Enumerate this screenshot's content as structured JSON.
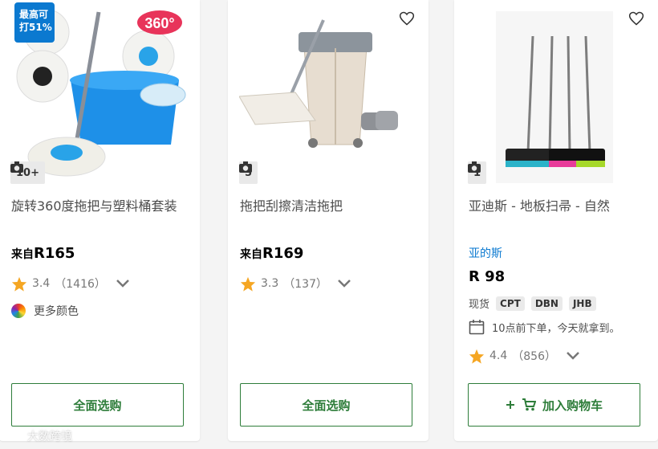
{
  "cards": [
    {
      "badge_line1": "最高可",
      "badge_line2": "打51%",
      "photo_count": "10+",
      "title": "旋转360度拖把与塑料桶套装",
      "price_prefix": "来自",
      "price": "R165",
      "rating": "3.4",
      "reviews": "（1416）",
      "colors_label": "更多颜色",
      "button_label": "全面选购",
      "image_text": "360°"
    },
    {
      "photo_count": "5",
      "title": "拖把刮擦清洁拖把",
      "price_prefix": "来自",
      "price": "R169",
      "rating": "3.3",
      "reviews": "（137）",
      "button_label": "全面选购"
    },
    {
      "photo_count": "1",
      "title": "亚迪斯 - 地板扫帚 - 自然",
      "brand": "亚的斯",
      "price": "R 98",
      "stock_label": "现货",
      "stock_locations": [
        "CPT",
        "DBN",
        "JHB"
      ],
      "delivery_text": "10点前下单，今天就拿到。",
      "rating": "4.4",
      "reviews": "（856）",
      "button_label": "加入购物车"
    }
  ],
  "watermark": "大数跨境",
  "colors": {
    "green": "#2e7d3a",
    "blue": "#0b79d0",
    "star": "#f5a623"
  }
}
